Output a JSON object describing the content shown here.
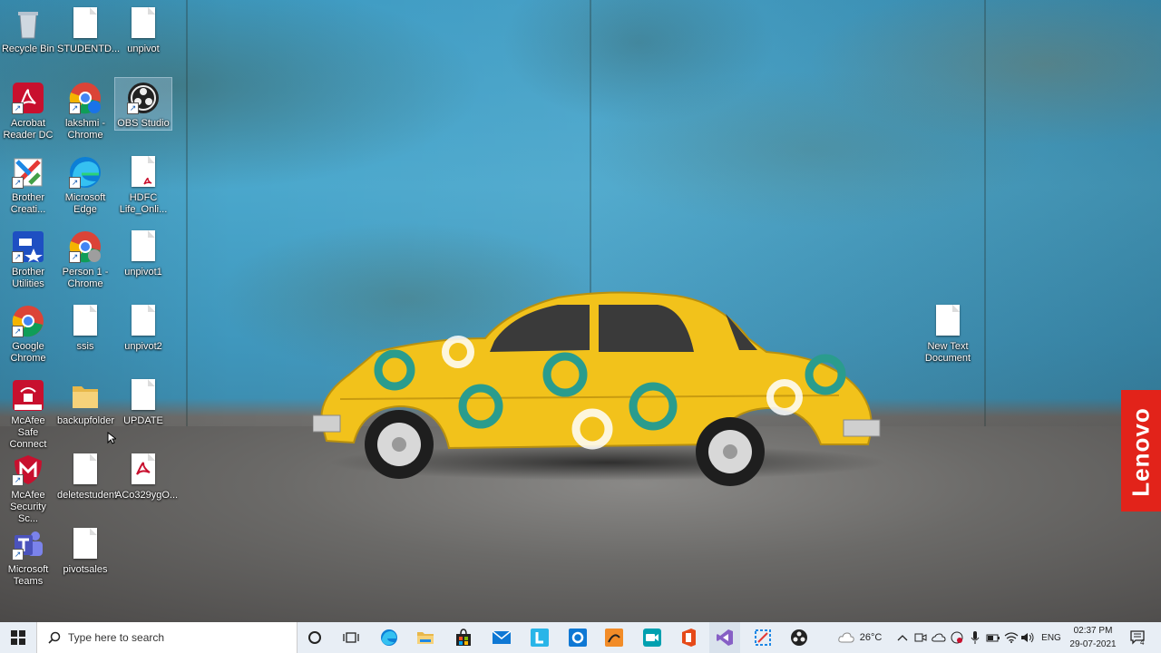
{
  "desktop_icons": [
    {
      "name": "Recycle Bin",
      "id": "recycle-bin"
    },
    {
      "name": "STUDENTD...",
      "id": "studentd"
    },
    {
      "name": "unpivot",
      "id": "unpivot"
    },
    {
      "name": "Acrobat Reader DC",
      "id": "acrobat"
    },
    {
      "name": "lakshmi - Chrome",
      "id": "lakshmi-chrome"
    },
    {
      "name": "OBS Studio",
      "id": "obs"
    },
    {
      "name": "Brother Creati...",
      "id": "brother-creative"
    },
    {
      "name": "Microsoft Edge",
      "id": "edge"
    },
    {
      "name": "HDFC Life_Onli...",
      "id": "hdfc"
    },
    {
      "name": "Brother Utilities",
      "id": "brother-utilities"
    },
    {
      "name": "Person 1 - Chrome",
      "id": "person1-chrome"
    },
    {
      "name": "unpivot1",
      "id": "unpivot1"
    },
    {
      "name": "Google Chrome",
      "id": "google-chrome"
    },
    {
      "name": "ssis",
      "id": "ssis"
    },
    {
      "name": "unpivot2",
      "id": "unpivot2"
    },
    {
      "name": "McAfee Safe Connect",
      "id": "mcafee-safe"
    },
    {
      "name": "backupfolder",
      "id": "backupfolder"
    },
    {
      "name": "UPDATE",
      "id": "update"
    },
    {
      "name": "McAfee Security Sc...",
      "id": "mcafee-security"
    },
    {
      "name": "deletestudent",
      "id": "deletestudent"
    },
    {
      "name": "ACo329ygO...",
      "id": "aco329"
    },
    {
      "name": "Microsoft Teams",
      "id": "teams"
    },
    {
      "name": "pivotsales",
      "id": "pivotsales"
    },
    {
      "name": "New Text Document",
      "id": "new-text-doc"
    }
  ],
  "wallpaper": {
    "brand": "Lenovo",
    "brand_color": "#e2231a",
    "car_color": "#f2c21b"
  },
  "taskbar": {
    "search_placeholder": "Type here to search",
    "pinned_apps": [
      "task-view",
      "file-explorer",
      "microsoft-store",
      "mail",
      "lucid",
      "outlook",
      "sketch-app",
      "zoom",
      "office",
      "visual-studio",
      "snipping-tool",
      "obs-studio"
    ],
    "weather": "26°C",
    "language": "ENG",
    "time": "02:37 PM",
    "date": "29-07-2021",
    "notifications": "4"
  }
}
